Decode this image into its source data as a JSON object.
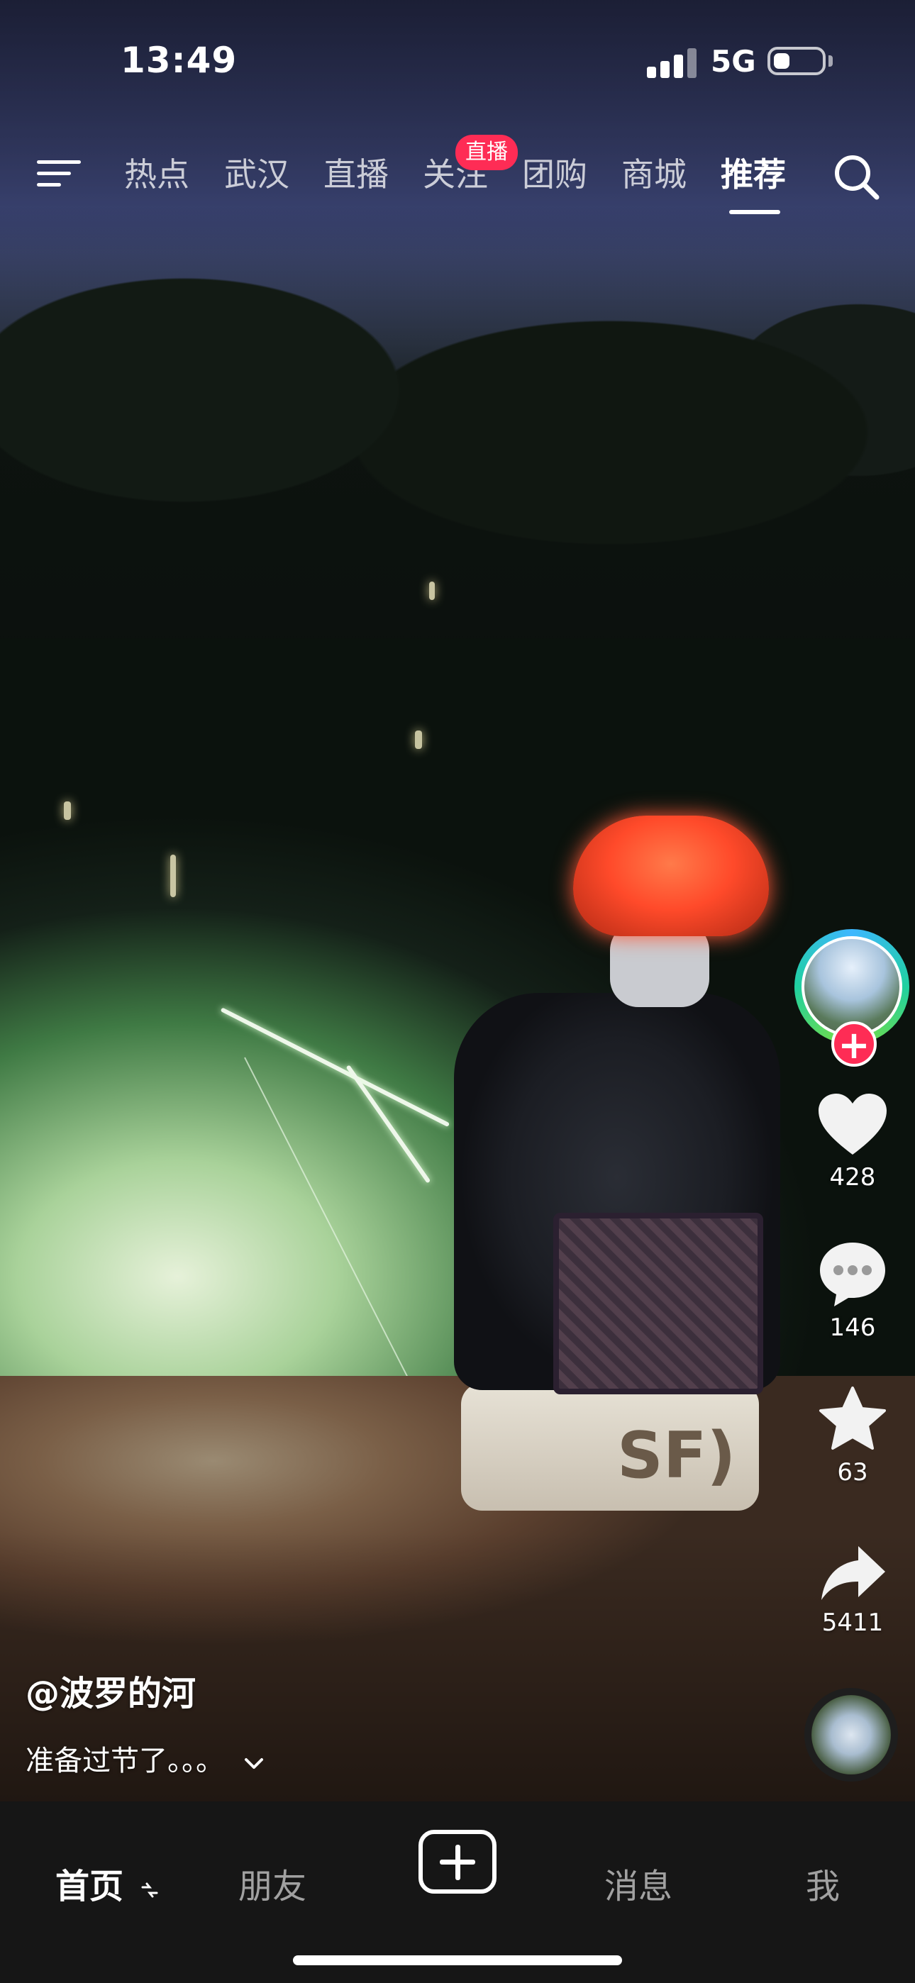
{
  "status_bar": {
    "time": "13:49",
    "network": "5G",
    "battery_level": 0.35
  },
  "top_nav": {
    "tabs": [
      {
        "label": "热点"
      },
      {
        "label": "武汉"
      },
      {
        "label": "直播"
      },
      {
        "label": "关注"
      },
      {
        "label": "团购"
      },
      {
        "label": "商城"
      },
      {
        "label": "推荐",
        "active": true
      }
    ],
    "live_badge": "直播",
    "icons": [
      "menu-icon",
      "search-icon"
    ]
  },
  "actions": {
    "like_count": "428",
    "comment_count": "146",
    "favorite_count": "63",
    "share_count": "5411",
    "icons": [
      "heart-icon",
      "comment-icon",
      "star-icon",
      "share-icon"
    ]
  },
  "post": {
    "author": "@波罗的河",
    "caption": "准备过节了。。。"
  },
  "bottom_tabs": [
    {
      "label": "首页",
      "active": true
    },
    {
      "label": "朋友"
    },
    {
      "label": "消息"
    },
    {
      "label": "我"
    }
  ],
  "colors": {
    "accent": "#fe2c55",
    "tabbar_bg": "#161616"
  }
}
